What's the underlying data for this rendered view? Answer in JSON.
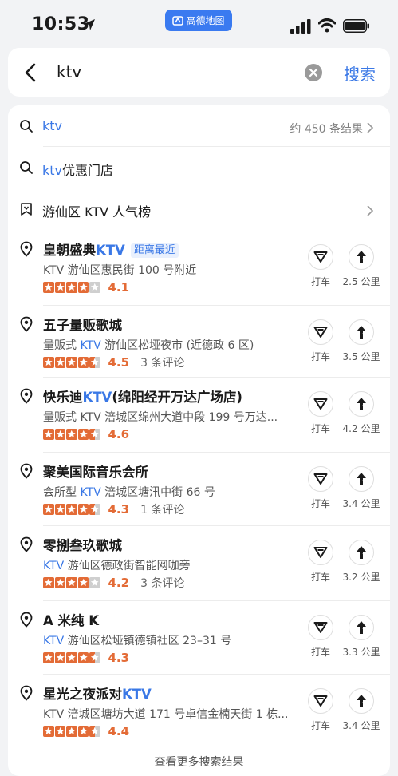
{
  "status": {
    "time": "10:53",
    "app_badge": "高德地图"
  },
  "search": {
    "query": "ktv",
    "button": "搜索"
  },
  "suggestions": [
    {
      "prefix": "ktv",
      "suffix": "",
      "count": "约 450 条结果"
    },
    {
      "prefix": "ktv",
      "suffix": "优惠门店",
      "count": ""
    },
    {
      "prefix": "",
      "suffix": "游仙区 KTV 人气榜",
      "count": ""
    }
  ],
  "results": [
    {
      "name_pre": "皇朝盛典",
      "name_hl": "KTV",
      "name_post": "",
      "tag": "距离最近",
      "addr_pre": "KTV  游仙区惠民街 100 号附近",
      "addr_hl": "",
      "addr_post": "",
      "rating": 4.1,
      "rating_text": "4.1",
      "reviews": "",
      "taxi": "打车",
      "distance": "2.5 公里"
    },
    {
      "name_pre": "五子量贩歌城",
      "name_hl": "",
      "name_post": "",
      "tag": "",
      "addr_pre": "量贩式 ",
      "addr_hl": "KTV",
      "addr_post": "  游仙区松垭夜市 (近德政 6 区)",
      "rating": 4.5,
      "rating_text": "4.5",
      "reviews": "3 条评论",
      "taxi": "打车",
      "distance": "3.5 公里"
    },
    {
      "name_pre": "快乐迪",
      "name_hl": "KTV",
      "name_post": "(绵阳经开万达广场店)",
      "tag": "",
      "addr_pre": "量贩式 KTV  涪城区绵州大道中段 199 号万达...",
      "addr_hl": "",
      "addr_post": "",
      "rating": 4.6,
      "rating_text": "4.6",
      "reviews": "",
      "taxi": "打车",
      "distance": "4.2 公里"
    },
    {
      "name_pre": "聚美国际音乐会所",
      "name_hl": "",
      "name_post": "",
      "tag": "",
      "addr_pre": "会所型 ",
      "addr_hl": "KTV",
      "addr_post": "  涪城区塘汛中街 66 号",
      "rating": 4.3,
      "rating_text": "4.3",
      "reviews": "1 条评论",
      "taxi": "打车",
      "distance": "3.4 公里"
    },
    {
      "name_pre": "零捌叁玖歌城",
      "name_hl": "",
      "name_post": "",
      "tag": "",
      "addr_pre": "",
      "addr_hl": "KTV",
      "addr_post": "  游仙区德政街智能网咖旁",
      "rating": 4.2,
      "rating_text": "4.2",
      "reviews": "3 条评论",
      "taxi": "打车",
      "distance": "3.2 公里"
    },
    {
      "name_pre": "A 米纯 K",
      "name_hl": "",
      "name_post": "",
      "tag": "",
      "addr_pre": "",
      "addr_hl": "KTV",
      "addr_post": "  游仙区松垭镇德镇社区 23–31 号",
      "rating": 4.3,
      "rating_text": "4.3",
      "reviews": "",
      "taxi": "打车",
      "distance": "3.3 公里"
    },
    {
      "name_pre": "星光之夜派对",
      "name_hl": "KTV",
      "name_post": "",
      "tag": "",
      "addr_pre": "KTV  涪城区塘坊大道 171 号卓信金楠天街 1 栋...",
      "addr_hl": "",
      "addr_post": "",
      "rating": 4.4,
      "rating_text": "4.4",
      "reviews": "",
      "taxi": "打车",
      "distance": "3.4 公里"
    }
  ],
  "footer": {
    "more": "查看更多搜索结果"
  },
  "colors": {
    "accent": "#3a78e6",
    "star": "#e36b36"
  }
}
